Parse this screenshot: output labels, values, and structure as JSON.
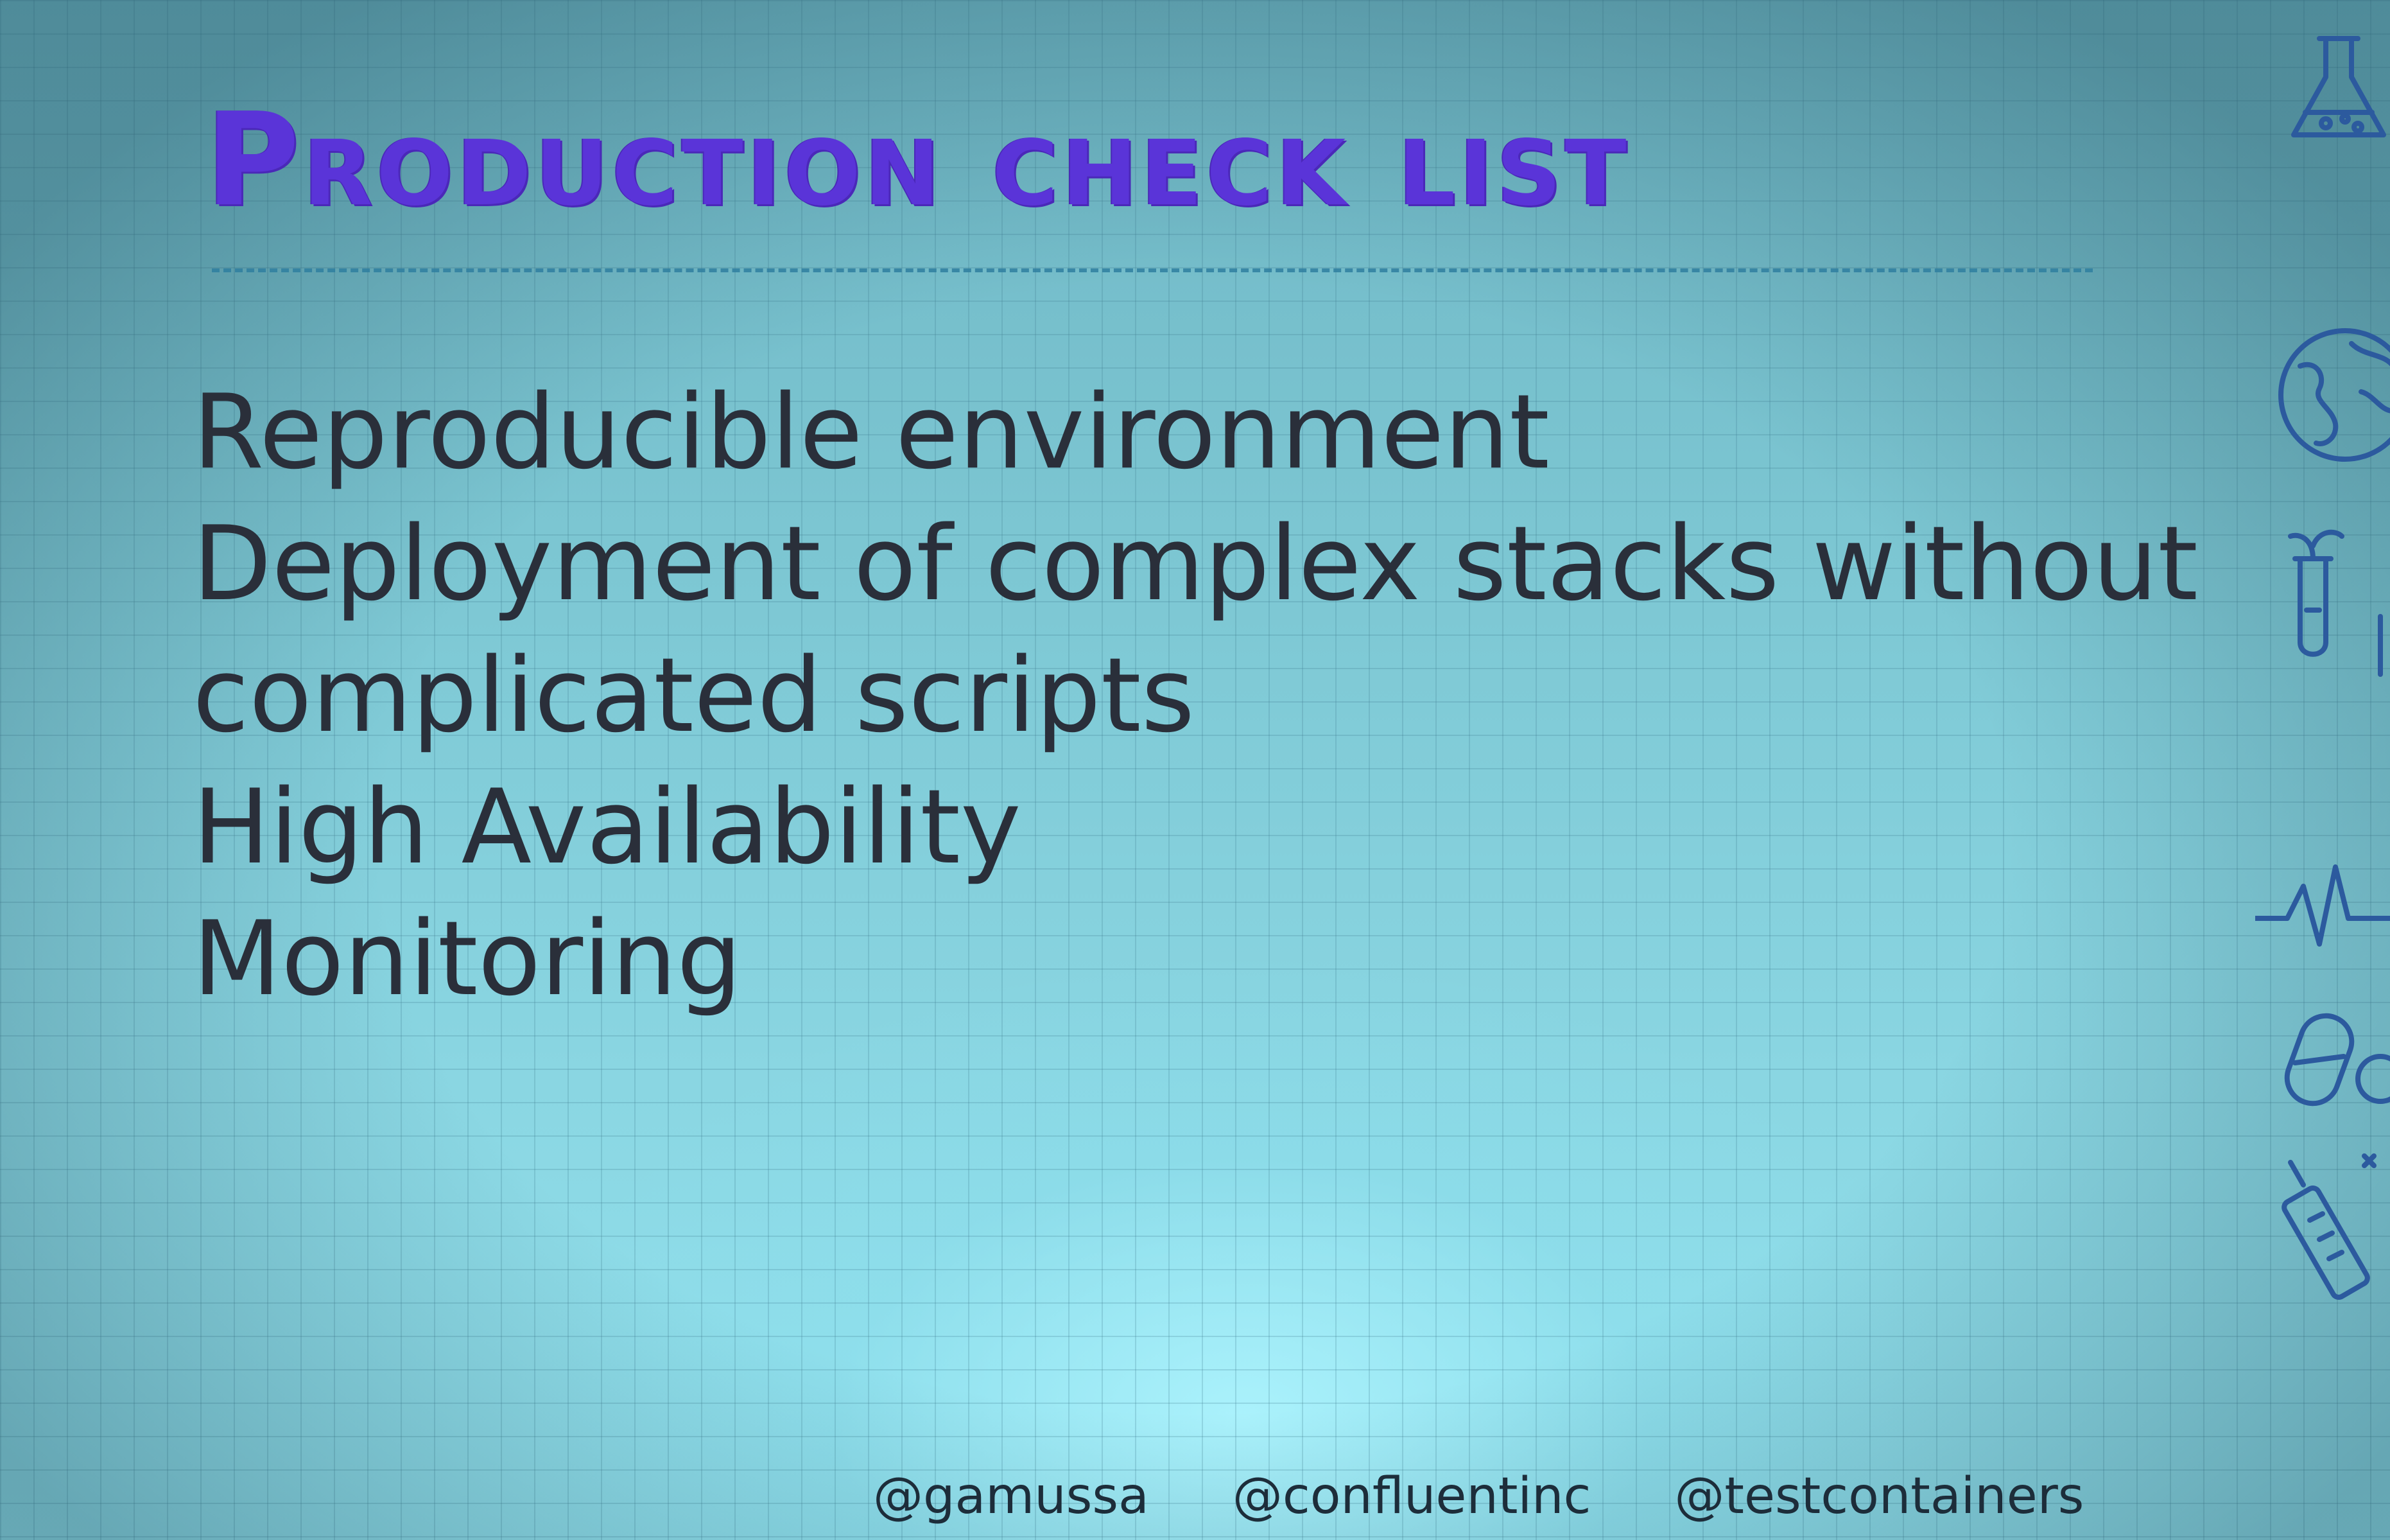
{
  "slide": {
    "title": "Production check list",
    "items": [
      "Reproducible environment",
      "Deployment of complex stacks without",
      "complicated scripts",
      "High Availability",
      "Monitoring"
    ],
    "footer": {
      "handles": [
        "@gamussa",
        "@confluentinc",
        "@testcontainers"
      ]
    },
    "decorations": [
      "flask-icon",
      "globe-icon",
      "test-tube-icon",
      "heartbeat-icon",
      "pill-icon",
      "syringe-icon"
    ],
    "colors": {
      "title": "#5a34d8",
      "text": "#2a2f3a",
      "background": "#7cc6d2",
      "divider": "#2f7fa0",
      "icons": "#2c5a9e"
    }
  }
}
